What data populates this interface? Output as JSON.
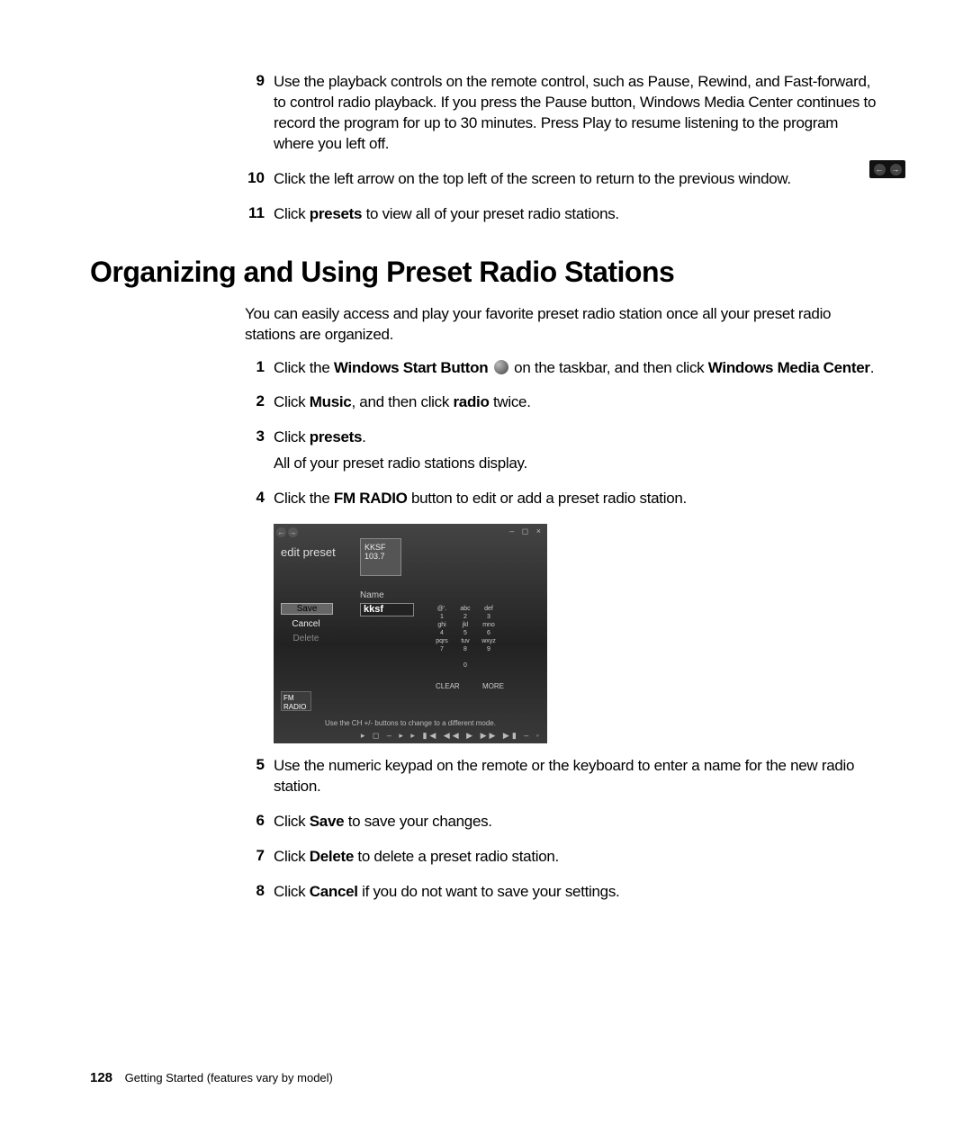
{
  "steps_a": [
    {
      "num": "9",
      "html": "Use the playback controls on the remote control, such as Pause, Rewind, and Fast-forward, to control radio playback. If you press the Pause button, Windows Media Center continues to record the program for up to 30 minutes. Press Play to resume listening to the program where you left off."
    },
    {
      "num": "10",
      "html": "Click the left arrow on the top left of the screen to return to the previous window."
    },
    {
      "num": "11",
      "html": "Click <b>presets</b> to view all of your preset radio stations."
    }
  ],
  "heading": "Organizing and Using Preset Radio Stations",
  "intro": "You can easily access and play your favorite preset radio station once all your preset radio stations are organized.",
  "steps_b": [
    {
      "num": "1",
      "html": "Click the <b>Windows Start Button</b> {START} on the taskbar, and then click <b>Windows Media Center</b>."
    },
    {
      "num": "2",
      "html": "Click <b>Music</b>, and then click <b>radio</b> twice."
    },
    {
      "num": "3",
      "html": "Click <b>presets</b>.",
      "extra": "All of your preset radio stations display."
    },
    {
      "num": "4",
      "html": "Click the <b>FM RADIO</b> button to edit or add a preset radio station."
    }
  ],
  "steps_c": [
    {
      "num": "5",
      "html": "Use the numeric keypad on the remote or the keyboard to enter a name for the new radio station."
    },
    {
      "num": "6",
      "html": "Click <b>Save</b> to save your changes."
    },
    {
      "num": "7",
      "html": "Click <b>Delete</b> to delete a preset radio station."
    },
    {
      "num": "8",
      "html": "Click <b>Cancel</b> if you do not want to save your settings."
    }
  ],
  "mc": {
    "title": "edit preset",
    "station_call": "KKSF",
    "station_freq": "103.7",
    "name_label": "Name",
    "name_value": "kksf",
    "save": "Save",
    "cancel": "Cancel",
    "delete": "Delete",
    "fm_radio": "FM RADIO",
    "clear": "CLEAR",
    "more": "MORE",
    "keys": [
      [
        "@'.",
        "abc",
        "def"
      ],
      [
        "1",
        "2",
        "3"
      ],
      [
        "ghi",
        "jkl",
        "mno"
      ],
      [
        "4",
        "5",
        "6"
      ],
      [
        "pqrs",
        "tuv",
        "wxyz"
      ],
      [
        "7",
        "8",
        "9"
      ],
      [
        "",
        "",
        "0"
      ],
      [
        "",
        "0",
        ""
      ]
    ],
    "keypad": [
      {
        "t": "@'.",
        "n": "1"
      },
      {
        "t": "abc",
        "n": "2"
      },
      {
        "t": "def",
        "n": "3"
      },
      {
        "t": "ghi",
        "n": "4"
      },
      {
        "t": "jkl",
        "n": "5"
      },
      {
        "t": "mno",
        "n": "6"
      },
      {
        "t": "pqrs",
        "n": "7"
      },
      {
        "t": "tuv",
        "n": "8"
      },
      {
        "t": "wxyz",
        "n": "9"
      },
      {
        "t": "",
        "n": ""
      },
      {
        "t": "",
        "n": "0"
      },
      {
        "t": "",
        "n": ""
      }
    ],
    "hint": "Use the CH +/- buttons to change to a different mode."
  },
  "footer": {
    "page": "128",
    "text": "Getting Started (features vary by model)"
  }
}
